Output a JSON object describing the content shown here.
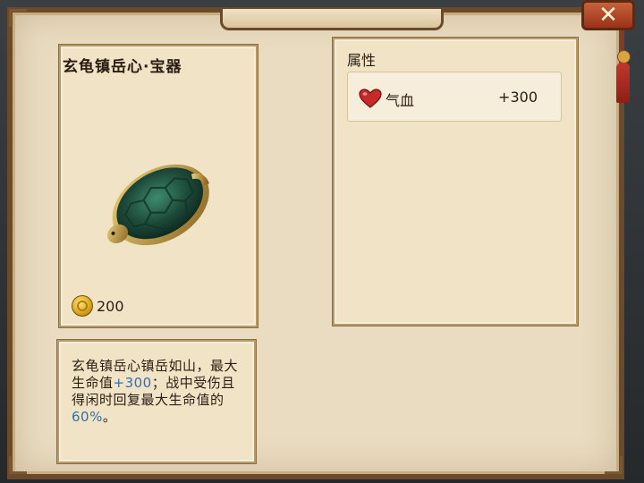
{
  "item": {
    "name": "玄龟镇岳心·宝器",
    "price": "200"
  },
  "attributes": {
    "header": "属性",
    "rows": [
      {
        "icon": "heart-icon",
        "name": "气血",
        "value": "+300"
      }
    ]
  },
  "description": {
    "part1": "玄龟镇岳心镇岳如山，最大生命值",
    "value1": "+300",
    "part2": "；战中受伤且得闲时回复最大生命值的",
    "value2": "60%",
    "part3": "。"
  },
  "colors": {
    "highlight": "#2f6fb3",
    "panel": "#e9dcc0",
    "close_button": "#b4472a"
  },
  "close_button": {
    "label": "✕"
  }
}
